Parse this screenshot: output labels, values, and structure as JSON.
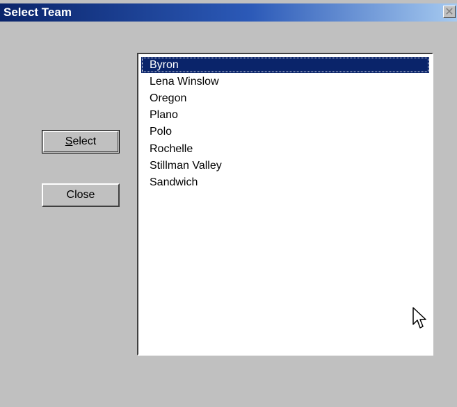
{
  "window": {
    "title": "Select Team",
    "close_glyph": "✕"
  },
  "buttons": {
    "select_label": "Select",
    "select_accesskey": "S",
    "select_rest": "elect",
    "close_label": "Close"
  },
  "team_list": {
    "selected_index": 0,
    "items": [
      {
        "label": "Byron"
      },
      {
        "label": "Lena Winslow"
      },
      {
        "label": "Oregon"
      },
      {
        "label": "Plano"
      },
      {
        "label": "Polo"
      },
      {
        "label": "Rochelle"
      },
      {
        "label": "Stillman Valley"
      },
      {
        "label": "Sandwich"
      }
    ]
  },
  "colors": {
    "dialog_face": "#c0c0c0",
    "title_start": "#0a246a",
    "title_end": "#a6caf0",
    "selection": "#0a246a"
  },
  "icons": {
    "close": "close-icon",
    "cursor": "mouse-pointer-icon"
  }
}
